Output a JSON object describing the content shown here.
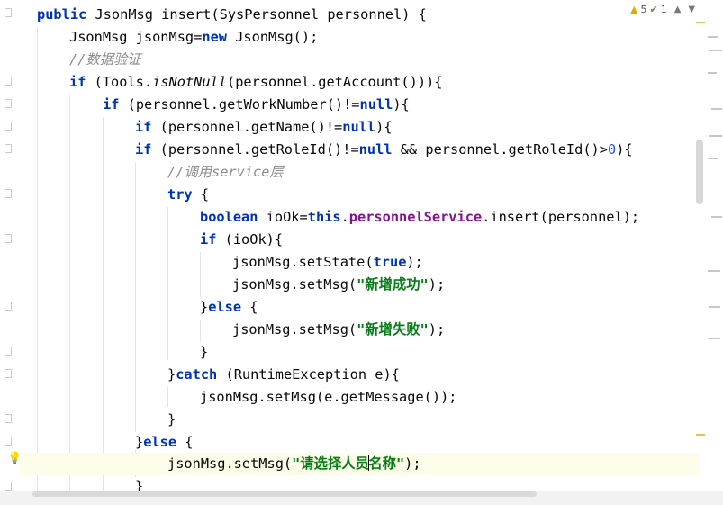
{
  "editor": {
    "inspections": {
      "warnings": "5",
      "weak_warnings": "1"
    },
    "lines": [
      [
        "public JsonMsg insert(SysPersonnel personnel) {"
      ],
      [
        "JsonMsg jsonMsg=new JsonMsg();"
      ],
      [
        "//数据验证"
      ],
      [
        "if (Tools.isNotNull(personnel.getAccount())){"
      ],
      [
        "if (personnel.getWorkNumber()!=null){"
      ],
      [
        "if (personnel.getName()!=null){"
      ],
      [
        "if (personnel.getRoleId()!=null && personnel.getRoleId()>0){"
      ],
      [
        "//调用service层"
      ],
      [
        "try {"
      ],
      [
        "boolean ioOk=this.personnelService.insert(personnel);"
      ],
      [
        "if (ioOk){"
      ],
      [
        "jsonMsg.setState(true);"
      ],
      [
        "jsonMsg.setMsg(\"新增成功\");"
      ],
      [
        "}else {"
      ],
      [
        "jsonMsg.setMsg(\"新增失败\");"
      ],
      [
        "}"
      ],
      [
        "}catch (RuntimeException e){"
      ],
      [
        "jsonMsg.setMsg(e.getMessage());"
      ],
      [
        "}"
      ],
      [
        "}else {"
      ],
      [
        "jsonMsg.setMsg(\"请选择人员名称\");"
      ],
      [
        "}"
      ]
    ],
    "tokens": {
      "l0": [
        "public",
        " JsonMsg insert(SysPersonnel personnel) {"
      ],
      "l1": [
        "JsonMsg jsonMsg=",
        "new",
        " JsonMsg();"
      ],
      "l2": [
        "//数据验证"
      ],
      "l3": [
        "if",
        " (Tools.",
        "isNotNull",
        "(personnel.getAccount())){"
      ],
      "l4": [
        "if",
        " (personnel.getWorkNumber()!=",
        "null",
        "){"
      ],
      "l5": [
        "if",
        " (personnel.getName()!=",
        "null",
        "){"
      ],
      "l6": [
        "if",
        " (personnel.getRoleId()!=",
        "null",
        " && personnel.getRoleId()>",
        "0",
        "){"
      ],
      "l7": [
        "//调用service层"
      ],
      "l8": [
        "try",
        " {"
      ],
      "l9": [
        "boolean",
        " ioOk=",
        "this",
        ".",
        "personnelService",
        ".insert(personnel);"
      ],
      "l10": [
        "if",
        " (ioOk){"
      ],
      "l11": [
        "jsonMsg.setState(",
        "true",
        ");"
      ],
      "l12": [
        "jsonMsg.setMsg(",
        "\"新增成功\"",
        ");"
      ],
      "l13": [
        "}",
        "else",
        " {"
      ],
      "l14": [
        "jsonMsg.setMsg(",
        "\"新增失败\"",
        ");"
      ],
      "l15": [
        "}"
      ],
      "l16": [
        "}",
        "catch",
        " (RuntimeException e){"
      ],
      "l17": [
        "jsonMsg.setMsg(e.getMessage());"
      ],
      "l18": [
        "}"
      ],
      "l19": [
        "}",
        "else",
        " {"
      ],
      "l20": [
        "jsonMsg.setMsg(",
        "\"请选择人员",
        "名称\"",
        ");"
      ],
      "l21": [
        "}"
      ]
    }
  }
}
